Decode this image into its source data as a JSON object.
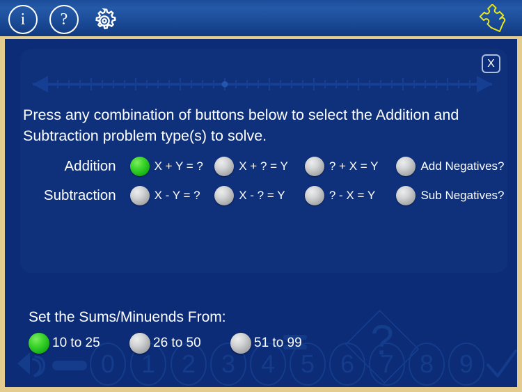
{
  "toolbar": {
    "info_icon": "info-icon",
    "help_icon": "question-mark-icon",
    "settings_icon": "gear-icon",
    "puzzle_icon": "puzzle-piece-icon",
    "info_label": "i",
    "help_label": "?",
    "accent_color": "#e3cc8e",
    "puzzle_color": "#e8e81e"
  },
  "dialog": {
    "close_label": "X",
    "instructions": "Press any combination of buttons below to select the Addition and Subtraction problem type(s) to solve.",
    "rows": [
      {
        "label": "Addition",
        "options": [
          {
            "text": "X + Y = ?",
            "selected": true
          },
          {
            "text": "X + ? = Y",
            "selected": false
          },
          {
            "text": "? + X = Y",
            "selected": false
          },
          {
            "text": "Add Negatives?",
            "selected": false
          }
        ]
      },
      {
        "label": "Subtraction",
        "options": [
          {
            "text": "X - Y = ?",
            "selected": false
          },
          {
            "text": "X - ? = Y",
            "selected": false
          },
          {
            "text": "? - X = Y",
            "selected": false
          },
          {
            "text": "Sub Negatives?",
            "selected": false
          }
        ]
      }
    ]
  },
  "range": {
    "title": "Set the Sums/Minuends From:",
    "options": [
      {
        "text": "10 to 25",
        "selected": true
      },
      {
        "text": "26 to 50",
        "selected": false
      },
      {
        "text": "51 to 99",
        "selected": false
      }
    ]
  },
  "background": {
    "keypad_digits": [
      "0",
      "1",
      "2",
      "3",
      "4",
      "5",
      "6",
      "7",
      "8",
      "9"
    ],
    "undo_icon": "undo-arrow-icon",
    "minus_icon": "minus-icon",
    "check_icon": "check-mark-icon",
    "answer_placeholder": "?",
    "numberline_icon": "number-line-icon"
  },
  "colors": {
    "background": "#0c2c77",
    "frame": "#e3cc8e",
    "selected": "#2ac81f",
    "unselected": "#c5c6c8",
    "text": "#ffffff"
  }
}
